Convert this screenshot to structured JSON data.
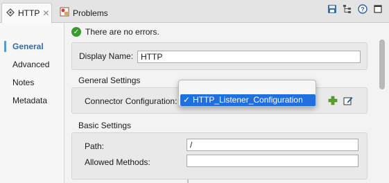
{
  "tabs": [
    {
      "label": "HTTP",
      "icon": "http-connector-icon",
      "active": true
    },
    {
      "label": "Problems",
      "icon": "problems-icon",
      "active": false
    }
  ],
  "toolbar_icons": [
    "save-icon",
    "tree-icon",
    "help-icon",
    "restore-window-icon"
  ],
  "nav": {
    "items": [
      {
        "label": "General",
        "active": true
      },
      {
        "label": "Advanced",
        "active": false
      },
      {
        "label": "Notes",
        "active": false
      },
      {
        "label": "Metadata",
        "active": false
      }
    ]
  },
  "status": {
    "text": "There are no errors.",
    "color": "#3a9a2f"
  },
  "general": {
    "display_name_label": "Display Name:",
    "display_name_value": "HTTP",
    "general_settings_title": "General Settings",
    "connector_config_label": "Connector Configuration:",
    "connector_config_value": "HTTP_Listener_Configuration"
  },
  "basic": {
    "title": "Basic Settings",
    "path_label": "Path:",
    "path_value": "/",
    "allowed_methods_label": "Allowed Methods:",
    "allowed_methods_value": ""
  },
  "colors": {
    "accent": "#2b6cb6",
    "selection": "#1f6fe0"
  }
}
